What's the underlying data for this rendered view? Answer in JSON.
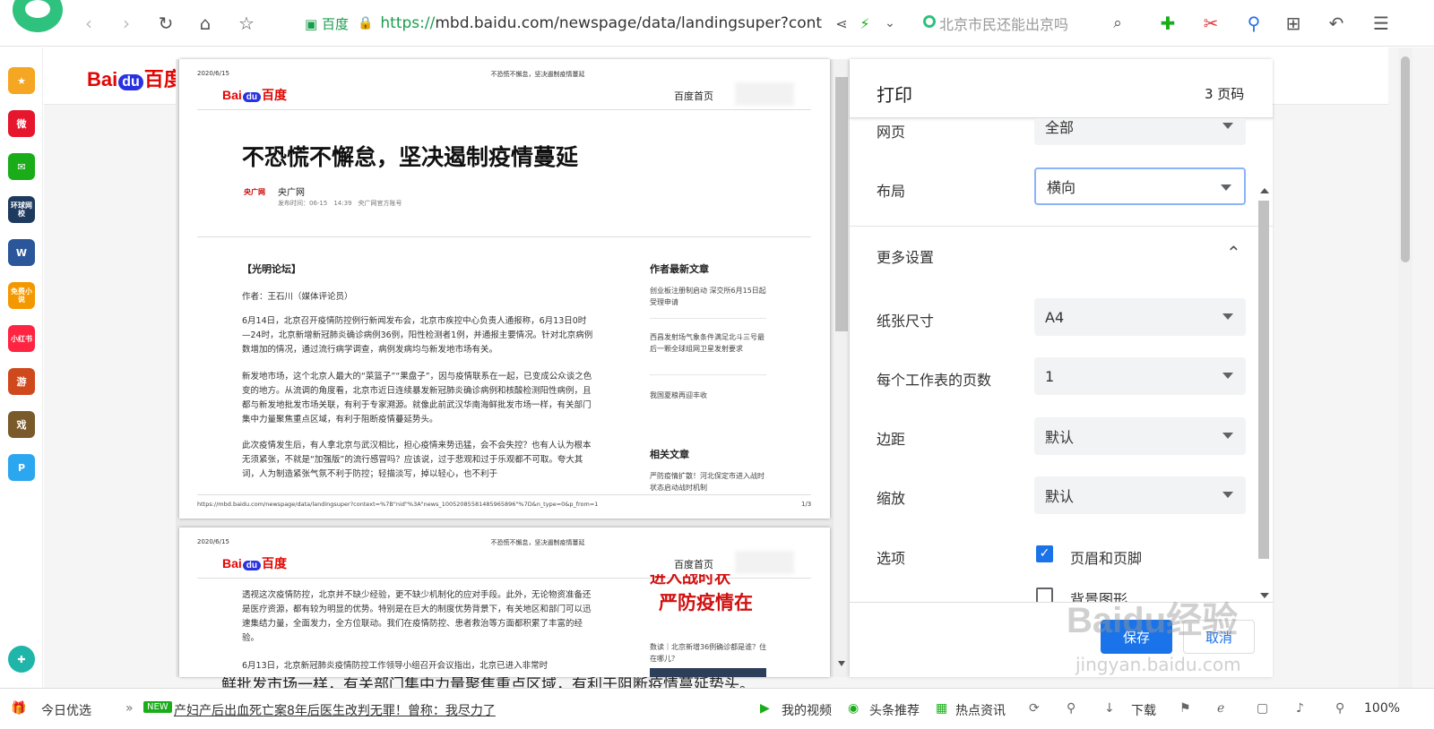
{
  "browser": {
    "url_prefix": "https://",
    "url_rest": "mbd.baidu.com/newspage/data/landingsuper?cont",
    "cert_label": "百度",
    "search_placeholder": "北京市民还能出京吗",
    "icons": [
      "back-icon",
      "forward-icon",
      "refresh-icon",
      "home-icon",
      "star-icon",
      "share-icon",
      "lightning-icon",
      "chevron-down-icon",
      "search-icon",
      "translate-icon",
      "scissors-icon",
      "magnifier-icon",
      "apps-icon",
      "undo-icon",
      "menu-icon"
    ]
  },
  "sidebar": {
    "items": [
      {
        "name": "favorites",
        "text": "★",
        "color": "#f5a623"
      },
      {
        "name": "weibo",
        "text": "微",
        "color": "#e6162d"
      },
      {
        "name": "mail",
        "text": "✉",
        "color": "#1aad19"
      },
      {
        "name": "huanqiu",
        "text": "环球网校",
        "color": "#1f3a5f"
      },
      {
        "name": "word",
        "text": "W",
        "color": "#2b579a"
      },
      {
        "name": "novel",
        "text": "免费小说",
        "color": "#f39800"
      },
      {
        "name": "xiaohongshu",
        "text": "小红书",
        "color": "#ff2442"
      },
      {
        "name": "game1",
        "text": "游",
        "color": "#d0491c"
      },
      {
        "name": "game2",
        "text": "戏",
        "color": "#7a5a2a"
      },
      {
        "name": "p-app",
        "text": "P",
        "color": "#2ba7f0"
      }
    ]
  },
  "preview": {
    "date": "2020/6/15",
    "header_title": "不恐慌不懈怠，坚决遏制疫情蔓延",
    "home_link": "百度首页",
    "headline": "不恐慌不懈怠，坚决遏制疫情蔓延",
    "source": "央广网",
    "meta": "发布时间：06-15　14:39　央广网官方账号",
    "section": "【光明论坛】",
    "author": "作者：王石川（媒体评论员）",
    "para1": "6月14日，北京召开疫情防控例行新闻发布会，北京市疾控中心负责人通报称，6月13日0时—24时，北京新增新冠肺炎确诊病例36例，阳性检测者1例，并通报主要情况。针对北京病例数增加的情况，通过流行病学调查，病例发病均与新发地市场有关。",
    "para2": "新发地市场，这个北京人最大的“菜篮子”“果盘子”，因与疫情联系在一起，已变成公众谈之色变的地方。从流调的角度看，北京市近日连续暴发新冠肺炎确诊病例和核酸检测阳性病例，且都与新发地批发市场关联，有利于专家溯源。就像此前武汉华南海鲜批发市场一样，有关部门集中力量聚焦重点区域，有利于阻断疫情蔓延势头。",
    "para3": "此次疫情发生后，有人拿北京与武汉相比，担心疫情来势迅猛，会不会失控？也有人认为根本无须紧张，不就是“加强版”的流行感冒吗？应该说，过于悲观和过于乐观都不可取。夸大其词，人为制造紧张气氛不利于防控；轻描淡写，掉以轻心，也不利于",
    "side_heading1": "作者最新文章",
    "side_items1": [
      "创业板注册制启动 深交所6月15日起受理申请",
      "西昌发射场气象条件满足北斗三号最后一颗全球组网卫星发射要求",
      "我国夏粮再迎丰收"
    ],
    "side_heading2": "相关文章",
    "side_item2": "严防疫情扩散！河北保定市进入战时状态启动战时机制",
    "footer_url": "https://mbd.baidu.com/newspage/data/landingsuper?context=%7B\"nid\"%3A\"news_10052085581485965896\"%7D&n_type=0&p_from=1",
    "footer_page": "1/3",
    "p2_para": "透视这次疫情防控，北京并不缺少经验，更不缺少机制化的应对手段。此外，无论物资准备还是医疗资源，都有较为明显的优势。特别是在巨大的制度优势背景下，有关地区和部门可以迅速集结力量，全面发力，全方位联动。我们在疫情防控、患者救治等方面都积累了丰富的经验。",
    "p2_para2": "6月13日，北京新冠肺炎疫情防控工作领导小组召开会议指出，北京已进入非常时",
    "p2_banner": "严防疫情在",
    "p2_banner_top": "进入战时状",
    "p2_side": "数读｜北京新增36例确诊都是谁？住在哪儿？"
  },
  "background_text": "鲜批发市场一样，有关部门集中力量聚焦重点区域，有利于阻断疫情蔓延势头。",
  "print_panel": {
    "title": "打印",
    "page_count": "3 页码",
    "pages_label": "网页",
    "pages_value": "全部",
    "layout_label": "布局",
    "layout_value": "横向",
    "more_settings": "更多设置",
    "paper_label": "纸张尺寸",
    "paper_value": "A4",
    "per_sheet_label": "每个工作表的页数",
    "per_sheet_value": "1",
    "margin_label": "边距",
    "margin_value": "默认",
    "scale_label": "缩放",
    "scale_value": "默认",
    "options_label": "选项",
    "opt_headers": "页眉和页脚",
    "opt_headers_checked": true,
    "opt_bg": "背景图形",
    "opt_bg_checked": false,
    "save_button": "保存",
    "cancel_button": "取消",
    "accent": "#1a73e8"
  },
  "watermark": {
    "brand": "Baidu经验",
    "url": "jingyan.baidu.com"
  },
  "bottombar": {
    "today": "今日优选",
    "new_badge": "NEW",
    "headline": "产妇产后出血死亡案8年后医生改判无罪！曾称：我尽力了",
    "video": "我的视频",
    "toutiao": "头条推荐",
    "news": "热点资讯",
    "download": "下载",
    "zoom": "100%"
  }
}
